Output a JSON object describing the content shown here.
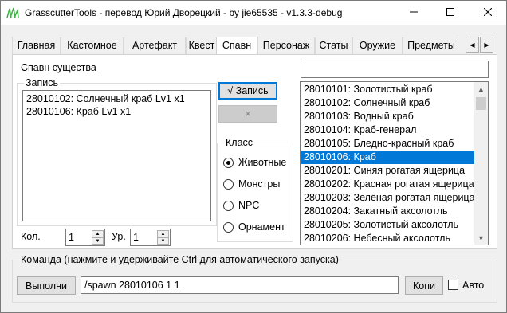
{
  "window": {
    "title": "GrasscutterTools - перевод Юрий Дворецкий  - by jie65535  - v1.3.3-debug"
  },
  "tabs": [
    {
      "label": "Главная"
    },
    {
      "label": "Кастомное"
    },
    {
      "label": "Артефакт"
    },
    {
      "label": "Квест"
    },
    {
      "label": "Спавн"
    },
    {
      "label": "Персонаж"
    },
    {
      "label": "Статы"
    },
    {
      "label": "Оружие"
    },
    {
      "label": "Предметы"
    }
  ],
  "active_tab": "Спавн",
  "spawn": {
    "section_label": "Спавн существа",
    "records_group_title": "Запись",
    "records": [
      "28010102: Солнечный краб Lv1 x1",
      "28010106: Краб Lv1 x1"
    ],
    "add_record_label": "√ Запись",
    "remove_record_label": "×",
    "class_group_title": "Класс",
    "classes": [
      {
        "label": "Животные",
        "checked": true
      },
      {
        "label": "Монстры",
        "checked": false
      },
      {
        "label": "NPC",
        "checked": false
      },
      {
        "label": "Орнамент",
        "checked": false
      }
    ],
    "count_label": "Кол.",
    "count_value": "1",
    "level_label": "Ур.",
    "level_value": "1",
    "search_value": "",
    "mobs": [
      "28010101: Золотистый краб",
      "28010102: Солнечный краб",
      "28010103: Водный краб",
      "28010104: Краб-генерал",
      "28010105: Бледно-красный краб",
      "28010106: Краб",
      "28010201: Синяя рогатая ящерица",
      "28010202: Красная рогатая ящерица",
      "28010203: Зелёная рогатая ящерица",
      "28010204: Закатный аксолотль",
      "28010205: Золотистый аксолотль",
      "28010206: Небесный аксолотль"
    ],
    "selected_mob": "28010106: Краб"
  },
  "command": {
    "group_title": "Команда (нажмите и удерживайте Ctrl для автоматического запуска)",
    "run_label": "Выполни",
    "value": "/spawn 28010106 1 1",
    "copy_label": "Копи",
    "auto_label": "Авто",
    "auto_checked": false
  },
  "colors": {
    "accent": "#0078d7",
    "app_icon": "#3cb043"
  }
}
